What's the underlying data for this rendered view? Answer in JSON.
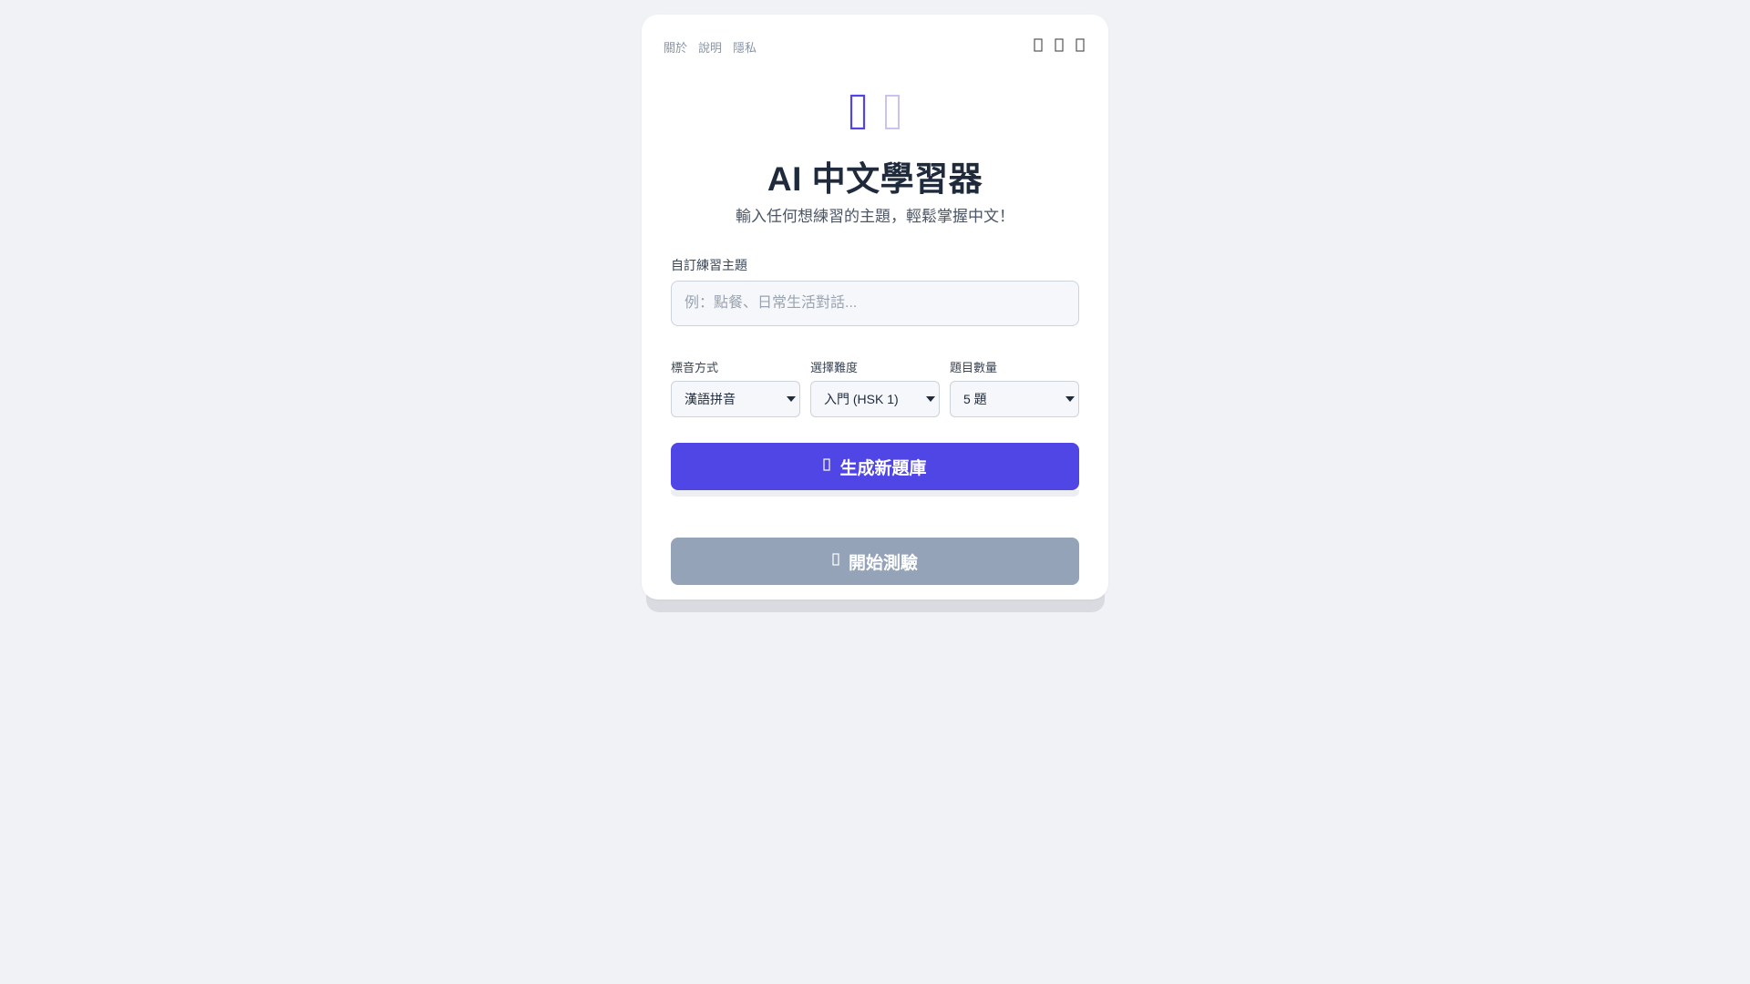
{
  "colors": {
    "background": "#f0f2f5",
    "card": "#ffffff",
    "primary": "#4f46e5",
    "disabled_button": "#94a3b8",
    "title": "#1f2a3c"
  },
  "nav": {
    "links": [
      "關於",
      "說明",
      "隱私"
    ],
    "icons": [
      "theme-toggle-icon",
      "history-icon",
      "settings-icon"
    ]
  },
  "hero": {
    "icons": [
      "chinese-character-icon",
      "sparkle-icon"
    ],
    "title": "AI 中文學習器",
    "subtitle": "輸入任何想練習的主題，輕鬆掌握中文！"
  },
  "form": {
    "topic_label": "自訂練習主題",
    "topic_value": "",
    "topic_placeholder": "例：點餐、日常生活對話...",
    "phonetic_label": "標音方式",
    "phonetic_value": "漢語拼音",
    "difficulty_label": "選擇難度",
    "difficulty_value": "入門 (HSK 1)",
    "count_label": "題目數量",
    "count_value": "5 題"
  },
  "buttons": {
    "generate_label": "生成新題庫",
    "generate_icon": "magic-wand-icon",
    "start_label": "開始測驗",
    "start_icon": "play-icon"
  }
}
